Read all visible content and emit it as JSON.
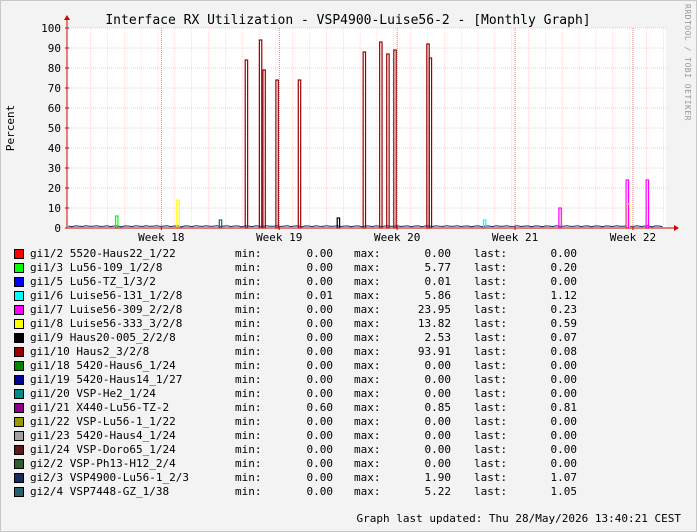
{
  "chart_data": {
    "type": "line",
    "title": "Interface RX Utilization - VSP4900-Luise56-2 - [Monthly Graph]",
    "ylabel": "Percent",
    "xlabel": "",
    "ylim": [
      0,
      100
    ],
    "yticks": [
      "0",
      "10",
      "20",
      "30",
      "40",
      "50",
      "60",
      "70",
      "80",
      "90",
      "100"
    ],
    "xticks": [
      "Week 18",
      "Week 19",
      "Week 20",
      "Week 21",
      "Week 22"
    ],
    "grid": true,
    "series": [
      {
        "name": "gi1/2 5520-Haus22_1/22",
        "color": "#ff0000",
        "min": "0.00",
        "max": "0.00",
        "last": "0.00"
      },
      {
        "name": "gi1/3 Lu56-109_1/2/8",
        "color": "#00ff00",
        "min": "0.00",
        "max": "5.77",
        "last": "0.20"
      },
      {
        "name": "gi1/5 Lu56-TZ_1/3/2",
        "color": "#0000ff",
        "min": "0.00",
        "max": "0.01",
        "last": "0.00"
      },
      {
        "name": "gi1/6 Luise56-131_1/2/8",
        "color": "#00ffff",
        "min": "0.01",
        "max": "5.86",
        "last": "1.12"
      },
      {
        "name": "gi1/7 Luise56-309_2/2/8",
        "color": "#ff00ff",
        "min": "0.00",
        "max": "23.95",
        "last": "0.23"
      },
      {
        "name": "gi1/8 Luise56-333_3/2/8",
        "color": "#ffff00",
        "min": "0.00",
        "max": "13.82",
        "last": "0.59"
      },
      {
        "name": "gi1/9 Haus20-005_2/2/8",
        "color": "#000000",
        "min": "0.00",
        "max": "2.53",
        "last": "0.07"
      },
      {
        "name": "gi1/10 Haus2_3/2/8",
        "color": "#990000",
        "min": "0.00",
        "max": "93.91",
        "last": "0.08"
      },
      {
        "name": "gi1/18 5420-Haus6_1/24",
        "color": "#008800",
        "min": "0.00",
        "max": "0.00",
        "last": "0.00"
      },
      {
        "name": "gi1/19 5420-Haus14_1/27",
        "color": "#000099",
        "min": "0.00",
        "max": "0.00",
        "last": "0.00"
      },
      {
        "name": "gi1/20 VSP-He2_1/24",
        "color": "#008b8b",
        "min": "0.00",
        "max": "0.00",
        "last": "0.00"
      },
      {
        "name": "gi1/21 X440-Lu56-TZ-2",
        "color": "#8b008b",
        "min": "0.60",
        "max": "0.85",
        "last": "0.81"
      },
      {
        "name": "gi1/22 VSP-Lu56-1_1/22",
        "color": "#999900",
        "min": "0.00",
        "max": "0.00",
        "last": "0.00"
      },
      {
        "name": "gi1/23 5420-Haus4_1/24",
        "color": "#a0a0a0",
        "min": "0.00",
        "max": "0.00",
        "last": "0.00"
      },
      {
        "name": "gi1/24 VSP-Doro65_1/24",
        "color": "#5c1a1a",
        "min": "0.00",
        "max": "0.00",
        "last": "0.00"
      },
      {
        "name": "gi2/2 VSP-Ph13-H12_2/4",
        "color": "#2f5d2f",
        "min": "0.00",
        "max": "0.00",
        "last": "0.00"
      },
      {
        "name": "gi2/3 VSP4900-Lu56-1_2/3",
        "color": "#1a2a5c",
        "min": "0.00",
        "max": "1.90",
        "last": "1.07"
      },
      {
        "name": "gi2/4 VSP7448-GZ_1/38",
        "color": "#2a5f6a",
        "min": "0.00",
        "max": "5.22",
        "last": "1.05"
      }
    ],
    "spikes": [
      {
        "series": "gi1/10 Haus2_3/2/8",
        "week": 18.72,
        "value": 84
      },
      {
        "series": "gi1/10 Haus2_3/2/8",
        "week": 18.84,
        "value": 94
      },
      {
        "series": "gi1/10 Haus2_3/2/8",
        "week": 18.87,
        "value": 79
      },
      {
        "series": "gi1/10 Haus2_3/2/8",
        "week": 18.98,
        "value": 74
      },
      {
        "series": "gi1/10 Haus2_3/2/8",
        "week": 19.17,
        "value": 74
      },
      {
        "series": "gi1/10 Haus2_3/2/8",
        "week": 19.72,
        "value": 88
      },
      {
        "series": "gi1/10 Haus2_3/2/8",
        "week": 19.86,
        "value": 93
      },
      {
        "series": "gi1/10 Haus2_3/2/8",
        "week": 19.92,
        "value": 87
      },
      {
        "series": "gi1/10 Haus2_3/2/8",
        "week": 19.98,
        "value": 89
      },
      {
        "series": "gi1/10 Haus2_3/2/8",
        "week": 20.26,
        "value": 92
      },
      {
        "series": "gi1/10 Haus2_3/2/8",
        "week": 20.28,
        "value": 85
      },
      {
        "series": "gi1/7 Luise56-309_2/2/8",
        "week": 21.95,
        "value": 24
      },
      {
        "series": "gi1/7 Luise56-309_2/2/8",
        "week": 22.12,
        "value": 24
      },
      {
        "series": "gi1/8 Luise56-333_3/2/8",
        "week": 18.14,
        "value": 14
      },
      {
        "series": "gi1/8 Luise56-333_3/2/8",
        "week": 21.96,
        "value": 12
      },
      {
        "series": "gi1/3 Lu56-109_1/2/8",
        "week": 17.62,
        "value": 6
      },
      {
        "series": "gi1/6 Luise56-131_1/2/8",
        "week": 20.74,
        "value": 4
      },
      {
        "series": "gi1/7 Luise56-309_2/2/8",
        "week": 21.38,
        "value": 10
      },
      {
        "series": "gi2/4 VSP7448-GZ_1/38",
        "week": 18.5,
        "value": 4
      },
      {
        "series": "gi1/9 Haus20-005_2/2/8",
        "week": 19.5,
        "value": 5
      }
    ]
  },
  "legend_labels": {
    "min": "min:",
    "max": "max:",
    "last": "last:"
  },
  "footer": {
    "updated": "Graph last updated: Thu 28/May/2026 13:40:21 CEST"
  },
  "watermark": "RRDTOOL / TOBI OETIKER"
}
